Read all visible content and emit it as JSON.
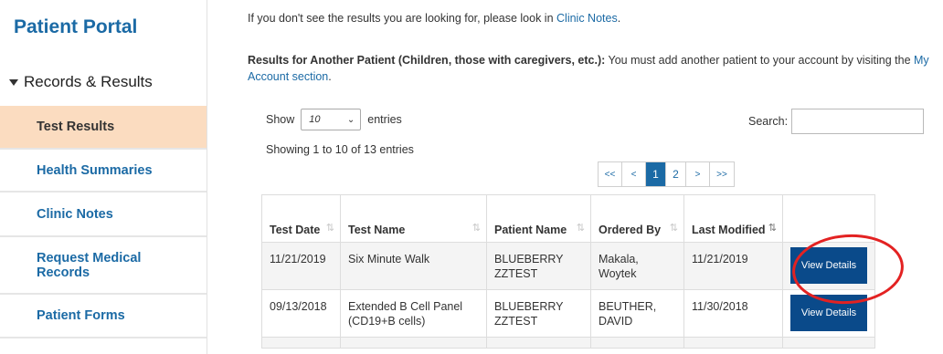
{
  "sidebar": {
    "title": "Patient Portal",
    "section": "Records & Results",
    "items": [
      {
        "label": "Test Results"
      },
      {
        "label": "Health Summaries"
      },
      {
        "label": "Clinic Notes"
      },
      {
        "label": "Request Medical Records"
      },
      {
        "label": "Patient Forms"
      }
    ]
  },
  "main": {
    "info1_prefix": "If you don't see the results you are looking for, please look in ",
    "info1_link": "Clinic Notes",
    "info1_suffix": ".",
    "info2_bold": "Results for Another Patient (Children, those with caregivers, etc.):",
    "info2_text": " You must add another patient to your account by visiting the ",
    "info2_link": "My Account section",
    "info2_suffix": "."
  },
  "controls": {
    "show_label": "Show",
    "entries_value": "10",
    "entries_label": "entries",
    "search_label": "Search:",
    "showing_text": "Showing 1 to 10 of 13 entries"
  },
  "pagination": {
    "first": "<<",
    "prev": "<",
    "pages": [
      "1",
      "2"
    ],
    "active_page": "1",
    "next": ">",
    "last": ">>"
  },
  "table": {
    "headers": [
      "Test Date",
      "Test Name",
      "Patient Name",
      "Ordered By",
      "Last Modified",
      ""
    ],
    "rows": [
      [
        "11/21/2019",
        "Six Minute Walk",
        "BLUEBERRY ZZTEST",
        "Makala, Woytek",
        "11/21/2019",
        "View Details"
      ],
      [
        "09/13/2018",
        "Extended B Cell Panel (CD19+B cells)",
        "BLUEBERRY ZZTEST",
        "BEUTHER, DAVID",
        "11/30/2018",
        "View Details"
      ]
    ]
  },
  "colors": {
    "brand_blue": "#1b6aa5",
    "active_bg": "#fbdcc0",
    "button_blue": "#0a4a8a",
    "annotation_red": "#e32222"
  },
  "icons": {
    "section_toggle": "triangle-down-icon",
    "select_chevron": "chevron-down-icon",
    "sort": "sort-arrows-icon"
  }
}
